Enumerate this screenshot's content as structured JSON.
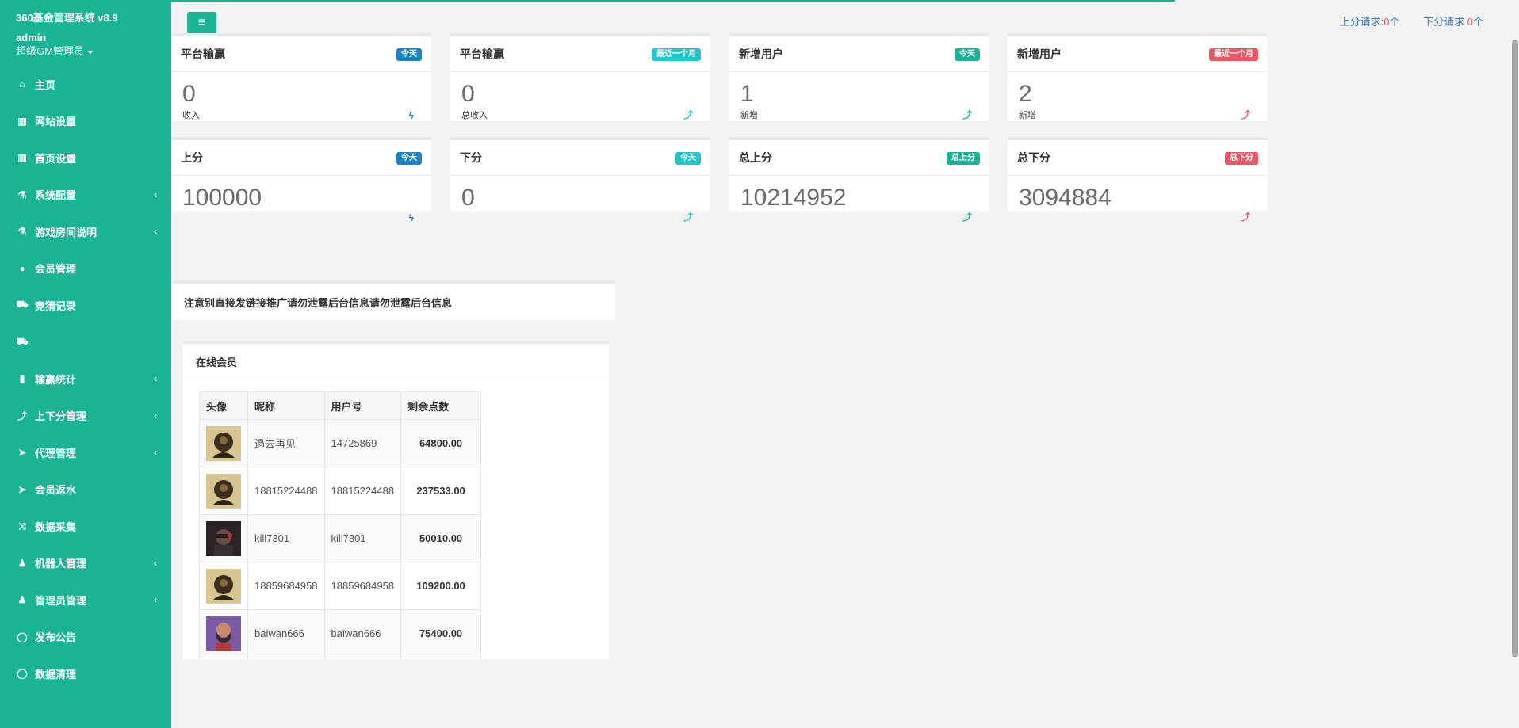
{
  "app": {
    "title": "360基金管理系统 v8.9",
    "user": "admin",
    "role": "超级GM管理员"
  },
  "sidebar": {
    "items": [
      {
        "label": "主页",
        "icon": "home-icon",
        "submenu": false
      },
      {
        "label": "网站设置",
        "icon": "columns-icon",
        "submenu": false
      },
      {
        "label": "首页设置",
        "icon": "columns-icon",
        "submenu": false
      },
      {
        "label": "系统配置",
        "icon": "flask-icon",
        "submenu": true
      },
      {
        "label": "游戏房间说明",
        "icon": "flask-icon",
        "submenu": true
      },
      {
        "label": "会员管理",
        "icon": "user-icon",
        "submenu": false
      },
      {
        "label": "竞猜记录",
        "icon": "car-icon",
        "submenu": false
      },
      {
        "label": "",
        "icon": "car-icon",
        "submenu": false
      },
      {
        "label": "输赢统计",
        "icon": "bar-chart-icon",
        "submenu": true
      },
      {
        "label": "上下分管理",
        "icon": "level-up-icon",
        "submenu": true
      },
      {
        "label": "代理管理",
        "icon": "paper-plane-icon",
        "submenu": true
      },
      {
        "label": "会员返水",
        "icon": "paper-plane-icon",
        "submenu": false
      },
      {
        "label": "数据采集",
        "icon": "random-icon",
        "submenu": false
      },
      {
        "label": "机器人管理",
        "icon": "male-icon",
        "submenu": true
      },
      {
        "label": "管理员管理",
        "icon": "male-icon",
        "submenu": true
      },
      {
        "label": "发布公告",
        "icon": "comment-icon",
        "submenu": false
      },
      {
        "label": "数据清理",
        "icon": "comment-icon",
        "submenu": false
      }
    ]
  },
  "topbar": {
    "up_label": "上分请求:",
    "up_count": "0",
    "up_unit": "个",
    "down_label": "下分请求",
    "down_count": "0",
    "down_unit": "个"
  },
  "stats": [
    {
      "title": "平台输赢",
      "badge": "今天",
      "badge_color": "#1c84c6",
      "value": "0",
      "sub": "收入",
      "icon": "bolt-icon"
    },
    {
      "title": "平台输赢",
      "badge": "最近一个月",
      "badge_color": "#23c6c8",
      "value": "0",
      "sub": "总收入",
      "icon": "level-up-icon"
    },
    {
      "title": "新增用户",
      "badge": "今天",
      "badge_color": "#1ab394",
      "value": "1",
      "sub": "新增",
      "icon": "level-up-icon"
    },
    {
      "title": "新增用户",
      "badge": "最近一个月",
      "badge_color": "#ed5565",
      "value": "2",
      "sub": "新增",
      "icon": "level-up-icon"
    },
    {
      "title": "上分",
      "badge": "今天",
      "badge_color": "#1c84c6",
      "value": "100000",
      "sub": "",
      "icon": "bolt-icon"
    },
    {
      "title": "下分",
      "badge": "今天",
      "badge_color": "#23c6c8",
      "value": "0",
      "sub": "",
      "icon": "level-up-icon"
    },
    {
      "title": "总上分",
      "badge": "总上分",
      "badge_color": "#1ab394",
      "value": "10214952",
      "sub": "",
      "icon": "level-up-icon"
    },
    {
      "title": "总下分",
      "badge": "总下分",
      "badge_color": "#ed5565",
      "value": "3094884",
      "sub": "",
      "icon": "level-up-icon"
    }
  ],
  "notice": "注意别直接发链接推广请勿泄露后台信息请勿泄露后台信息",
  "online": {
    "title": "在线会员",
    "columns": [
      "头像",
      "昵称",
      "用户号",
      "剩余点数"
    ],
    "rows": [
      {
        "nickname": "過去再见",
        "uid": "14725869",
        "points": "64800.00",
        "avatar": "warrior-avatar"
      },
      {
        "nickname": "18815224488",
        "uid": "18815224488",
        "points": "237533.00",
        "avatar": "warrior-avatar"
      },
      {
        "nickname": "kill7301",
        "uid": "kill7301",
        "points": "50010.00",
        "avatar": "ninja-avatar"
      },
      {
        "nickname": "18859684958",
        "uid": "18859684958",
        "points": "109200.00",
        "avatar": "warrior-avatar"
      },
      {
        "nickname": "baiwan666",
        "uid": "baiwan666",
        "points": "75400.00",
        "avatar": "bearded-avatar"
      }
    ]
  },
  "colors": {
    "primary": "#1ab394",
    "blue": "#1c84c6",
    "cyan": "#23c6c8",
    "red": "#ed5565"
  }
}
